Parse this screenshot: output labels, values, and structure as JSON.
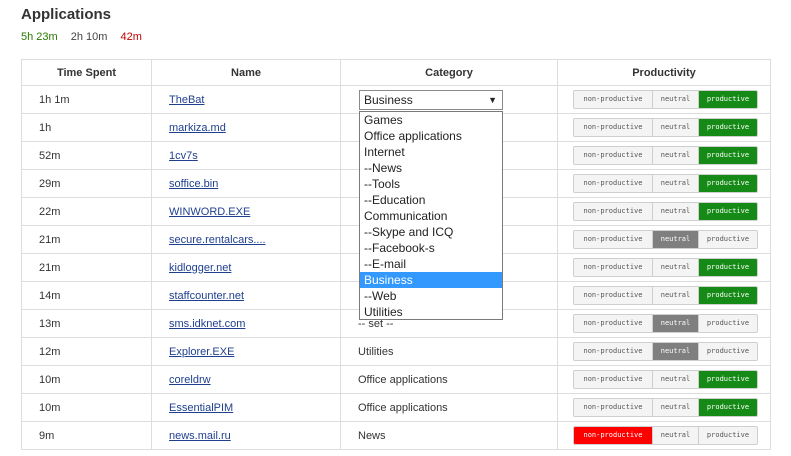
{
  "page": {
    "title": "Applications",
    "summary": {
      "productive": "5h 23m",
      "neutral": "2h 10m",
      "unproductive": "42m"
    }
  },
  "columns": [
    "Time Spent",
    "Name",
    "Category",
    "Productivity"
  ],
  "productivity_labels": {
    "non": "non-productive",
    "neu": "neutral",
    "pro": "productive"
  },
  "colors": {
    "productive": "#168a16",
    "neutral": "#7f7f7f",
    "unproductive": "#ff0000",
    "select_highlight": "#3399ff"
  },
  "rows": [
    {
      "time": "1h 1m",
      "name": "TheBat",
      "category": "Business",
      "productivity": "productive"
    },
    {
      "time": "1h",
      "name": "markiza.md",
      "category": "",
      "productivity": "productive"
    },
    {
      "time": "52m",
      "name": "1cv7s",
      "category": "",
      "productivity": "productive"
    },
    {
      "time": "29m",
      "name": "soffice.bin",
      "category": "",
      "productivity": "productive"
    },
    {
      "time": "22m",
      "name": "WINWORD.EXE",
      "category": "",
      "productivity": "productive"
    },
    {
      "time": "21m",
      "name": "secure.rentalcars....",
      "category": "",
      "productivity": "neutral"
    },
    {
      "time": "21m",
      "name": "kidlogger.net",
      "category": "",
      "productivity": "productive"
    },
    {
      "time": "14m",
      "name": "staffcounter.net",
      "category": "",
      "productivity": "productive"
    },
    {
      "time": "13m",
      "name": "sms.idknet.com",
      "category": "-- set --",
      "productivity": "neutral"
    },
    {
      "time": "12m",
      "name": "Explorer.EXE",
      "category": "Utilities",
      "productivity": "neutral"
    },
    {
      "time": "10m",
      "name": "coreldrw",
      "category": "Office applications",
      "productivity": "productive"
    },
    {
      "time": "10m",
      "name": "EssentialPIM",
      "category": "Office applications",
      "productivity": "productive"
    },
    {
      "time": "9m",
      "name": "news.mail.ru",
      "category": "News",
      "productivity": "unproductive"
    }
  ],
  "category_select": {
    "value": "Business",
    "arrow": "▼",
    "options": [
      "Games",
      "Office applications",
      "Internet",
      "--News",
      "--Tools",
      "--Education",
      "Communication",
      "--Skype and ICQ",
      "--Facebook-s",
      "--E-mail",
      "Business",
      "--Web",
      "Utilities"
    ],
    "selected_index": 10
  }
}
